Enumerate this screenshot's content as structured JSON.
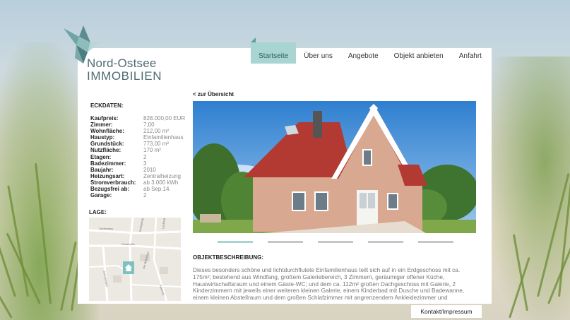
{
  "brand": {
    "line1": "Nord-Ostsee",
    "line2": "IMMOBILIEN",
    "logo_icon": "origami-bird-icon"
  },
  "nav": {
    "items": [
      {
        "label": "Startseite",
        "active": true
      },
      {
        "label": "Über uns",
        "active": false
      },
      {
        "label": "Angebote",
        "active": false
      },
      {
        "label": "Objekt anbieten",
        "active": false
      },
      {
        "label": "Anfahrt",
        "active": false
      }
    ]
  },
  "details": {
    "title": "ECKDATEN:",
    "rows": [
      {
        "key": "Kaufpreis:",
        "value": "828.000,00 EUR"
      },
      {
        "key": "Zimmer:",
        "value": "7,00"
      },
      {
        "key": "Wohnfläche:",
        "value": "212,00 m²"
      },
      {
        "key": "Haustyp:",
        "value": "Einfamilienhaus"
      },
      {
        "key": "Grundstück:",
        "value": "773,00 m²"
      },
      {
        "key": "Nutzfläche:",
        "value": "170 m²"
      },
      {
        "key": "Etagen:",
        "value": "2"
      },
      {
        "key": "Badezimmer:",
        "value": "3"
      },
      {
        "key": "Baujahr:",
        "value": "2010"
      },
      {
        "key": "Heizungsart:",
        "value": "Zentralheizung"
      },
      {
        "key": "Stromverbrauch:",
        "value": "ab 3.000 kWh"
      },
      {
        "key": "Bezugsfrei ab:",
        "value": "ab Sep.14."
      },
      {
        "key": "Garage:",
        "value": "2"
      }
    ]
  },
  "location": {
    "title": "LAGE:",
    "map_labels": [
      "Gartenweg",
      "Schlagweg",
      "Dorfstraße",
      "Am Wäldchen",
      "Lindweg",
      "Strandstraße",
      "Feldweg"
    ],
    "marker_icon": "house-marker-icon"
  },
  "main": {
    "back_link": "< zur Übersicht",
    "slider_count": 5,
    "active_slide": 0,
    "description_title": "OBJEKTBESCHREIBUNG:",
    "description": "Dieses besonders schöne und lichtdurchflutete Einfamilienhaus teilt sich auf in ein Erdgeschoss mit ca. 175m²; bestehend aus Windfang, großem Galeriebereich, 3 Zimmern, geräumiger offener Küche, Hauswirtschaftsraum und einem Gäste-WC; und dem ca. 112m² großen Dachgeschoss mit Galerie, 2 Kinderzimmern mit jeweils einer weiteren kleinen Galerie, einem Kinderbad mit Dusche und Badewanne, einem kleinen Abstellraum und dem großen Schlafzimmer mit angrenzendem Ankleidezimmer und"
  },
  "footer": {
    "label": "Kontakt/Impressum"
  },
  "colors": {
    "accent": "#a8d5d1",
    "accent_dark": "#5f9f9b",
    "brand_text": "#4f6b73",
    "roof": "#b23a32",
    "brick": "#d9a890"
  }
}
